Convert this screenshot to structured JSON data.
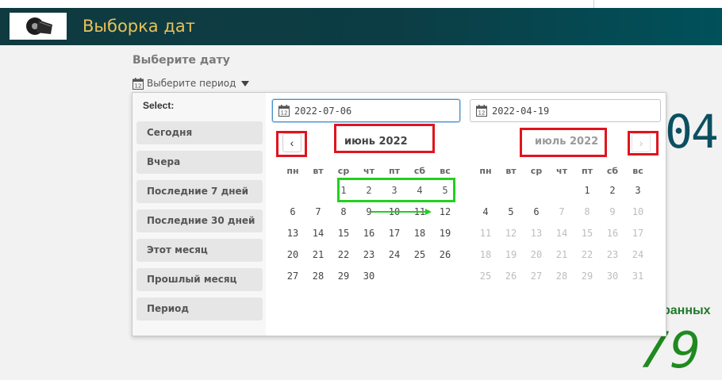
{
  "header": {
    "title": "Выборка дат",
    "logo": "film-reel-logo"
  },
  "sheet": {
    "title": "Выберите дату",
    "period_label": "Выберите период"
  },
  "kpi": {
    "big_value": "04",
    "label": "ранных",
    "number": "79"
  },
  "picker": {
    "select_label": "Select:",
    "presets": [
      "Сегодня",
      "Вчера",
      "Последние 7 дней",
      "Последние 30 дней",
      "Этот месяц",
      "Прошлый месяц",
      "Период"
    ],
    "start_date": "2022-07-06",
    "end_date": "2022-04-19",
    "weekdays": [
      "пн",
      "вт",
      "ср",
      "чт",
      "пт",
      "сб",
      "вс"
    ],
    "left_month": {
      "title": "июнь 2022",
      "rows": [
        [
          "",
          "",
          "1",
          "2",
          "3",
          "4",
          "5"
        ],
        [
          "6",
          "7",
          "8",
          "9",
          "10",
          "11",
          "12"
        ],
        [
          "13",
          "14",
          "15",
          "16",
          "17",
          "18",
          "19"
        ],
        [
          "20",
          "21",
          "22",
          "23",
          "24",
          "25",
          "26"
        ],
        [
          "27",
          "28",
          "29",
          "30",
          "",
          "",
          ""
        ]
      ],
      "highlighted": [
        "1",
        "2",
        "3",
        "4",
        "5"
      ]
    },
    "right_month": {
      "title": "июль 2022",
      "rows": [
        [
          "",
          "",
          "",
          "",
          "1",
          "2",
          "3"
        ],
        [
          "4",
          "5",
          "6",
          "7",
          "8",
          "9",
          "10"
        ],
        [
          "11",
          "12",
          "13",
          "14",
          "15",
          "16",
          "17"
        ],
        [
          "18",
          "19",
          "20",
          "21",
          "22",
          "23",
          "24"
        ],
        [
          "25",
          "26",
          "27",
          "28",
          "29",
          "30",
          "31"
        ]
      ],
      "active_days": [
        "1",
        "2",
        "3",
        "4",
        "5",
        "6"
      ]
    },
    "prev_symbol": "‹",
    "next_symbol": "›"
  },
  "colors": {
    "header_bg": "#0f3a3f",
    "title_gold": "#e8c15a",
    "annotation_red": "#e0141e",
    "annotation_green": "#22d01e",
    "kpi_teal": "#0b5060",
    "kpi_green": "#1f8a1f"
  }
}
